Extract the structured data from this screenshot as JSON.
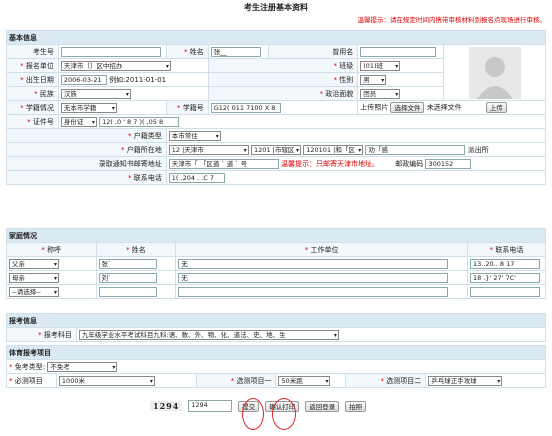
{
  "title": "考生注册基本资料",
  "warning": "温馨提示：请在规定时间内携带审核材料到报名点现场进行审核。",
  "basic": {
    "section": "基本信息",
    "exam_no_label": "考生号",
    "exam_no": "",
    "name_label": "姓名",
    "name": "张__",
    "former_label": "曾用名",
    "former": "",
    "unit_label": "报名单位",
    "unit": "天津市〔〕区中招办",
    "class_label": "班级",
    "class": "(01)班",
    "birth_label": "出生日期",
    "birth": "2006-03-21",
    "birth_example": "例如:2011-01-01",
    "sex_label": "性别",
    "sex": "男",
    "nation_label": "民族",
    "nation": "汉族",
    "political_label": "政治面貌",
    "political": "团员",
    "status_label": "学籍情况",
    "status": "无本市学籍",
    "sno_label": "学籍号",
    "sno": "G12( 011  7100 X 8",
    "photo_label": "上传照片",
    "choose_btn": "选择文件",
    "no_file": "未选择文件",
    "upload_btn": "上传",
    "idtype_label": "证件号",
    "idtype": "身份证",
    "idno": "12( ,0 ' 8 7 )( ,05 8",
    "hukou_type_label": "户籍类型",
    "hukou_type": "本市常住",
    "hukou_label": "户籍所在地",
    "hukou_city": "12 |天津市",
    "hukou_district": "1201 |市辖区",
    "hukou_area": "120101 |和「区",
    "hukou_street": "劝「感",
    "hukou_suffix": "派出所",
    "addr_label": "录取通知书邮寄地址",
    "addr": "天津市「  「区道 ` 道 ` 号",
    "addr_warn": "温馨提示：只邮寄天津市地址。",
    "post_label": "邮政编码",
    "post": "300152",
    "phone_label": "联系电话",
    "phone": "1(  .204 . .C  7"
  },
  "family": {
    "section": "家庭情况",
    "headers": [
      "称呼",
      "姓名",
      "工作单位",
      "联系电话"
    ],
    "rows": [
      {
        "rel": "父亲",
        "name": "张`",
        "work": "无",
        "tel": "13..20.. 8 17"
      },
      {
        "rel": "母亲",
        "name": "刘`",
        "work": "无",
        "tel": "18 .}' 27' 7C'"
      },
      {
        "rel": "--请选择--",
        "name": "",
        "work": "",
        "tel": ""
      }
    ]
  },
  "exam": {
    "section": "报考信息",
    "subject_label": "报考科目",
    "subject": "九年级学业水平考试科目九科:语、数、外、物、化、道法、史、地、生"
  },
  "pe": {
    "section": "体育报考项目",
    "exempt_label": "免考类型",
    "exempt": "不免考",
    "required_label": "必测项目",
    "required": "1000米",
    "opt1_label": "选测项目一",
    "opt1": "50米跑",
    "opt2_label": "选测项目二",
    "opt2": "乒乓球正手攻球"
  },
  "captcha": "1294",
  "captcha_input": "1294",
  "buttons": {
    "submit": "提交",
    "print": "确认打印",
    "back": "返回登录",
    "photo": "拍照"
  }
}
